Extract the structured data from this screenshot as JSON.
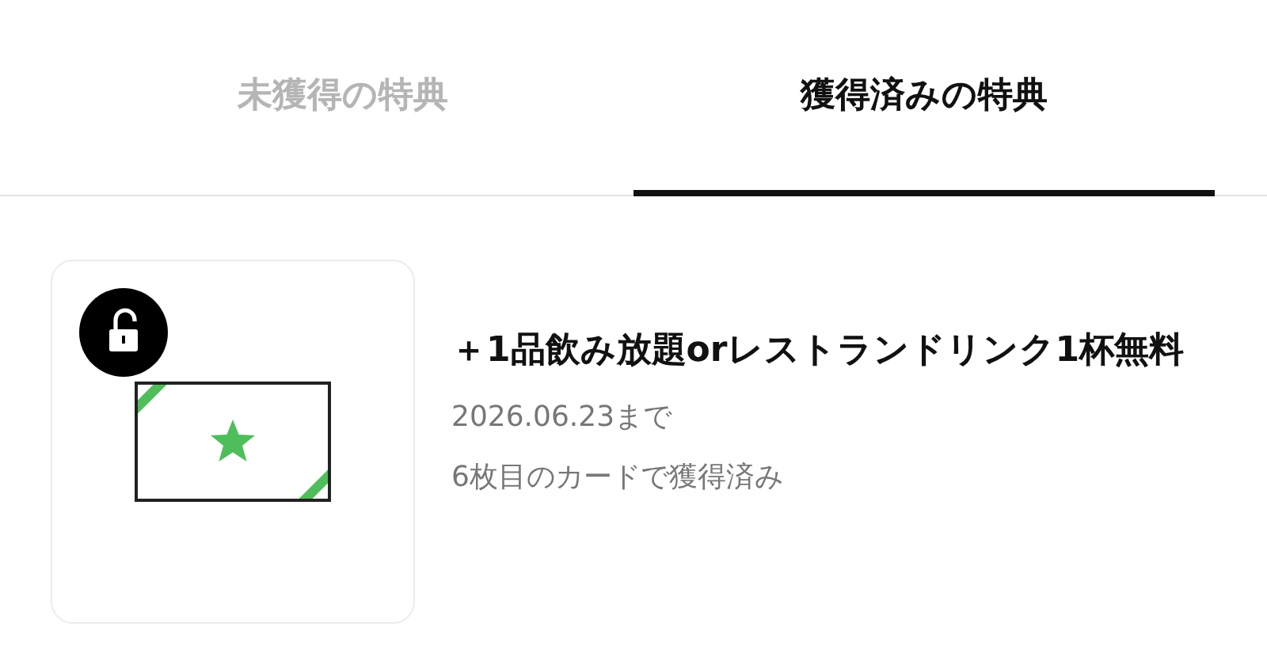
{
  "tabs": [
    {
      "label": "未獲得の特典",
      "selected": false
    },
    {
      "label": "獲得済みの特典",
      "selected": true
    }
  ],
  "rewards": [
    {
      "unlocked": true,
      "title": "＋1品飲み放題orレストランドリンク1杯無料",
      "expiry": "2026.06.23まで",
      "note": "6枚目のカードで獲得済み"
    }
  ]
}
